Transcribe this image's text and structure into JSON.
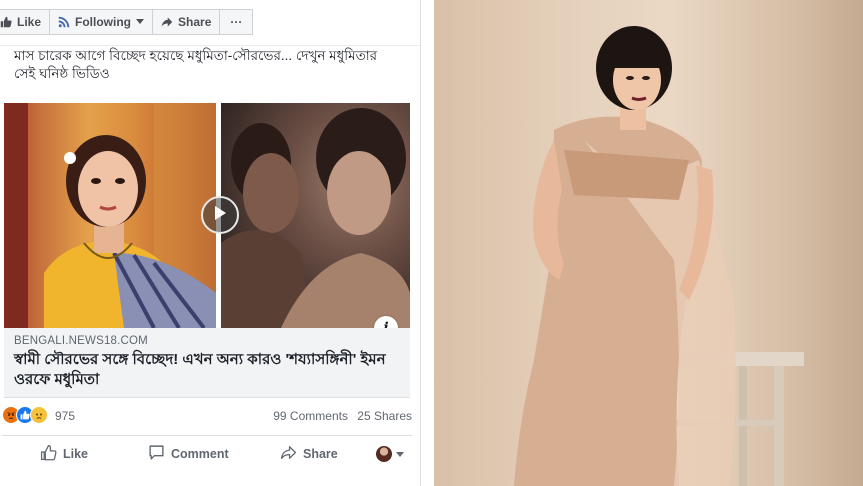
{
  "toolbar": {
    "like_label": "Like",
    "following_label": "Following",
    "share_label": "Share",
    "more_label": "···"
  },
  "post": {
    "caption": "মাস চারেক আগে বিচ্ছেদ হয়েছে মধুমিতা-সৌরভের... দেখুন মধুমিতার সেই ঘনিষ্ঠ ভিডিও",
    "link": {
      "domain": "BENGALI.NEWS18.COM",
      "headline": "স্বামী সৌরভের সঙ্গে বিচ্ছেদ! এখন অন্য কারও 'শয্যাসঙ্গিনী' ইমন ওরফে মধুমিতা"
    },
    "reactions": {
      "icons": [
        "angry-icon",
        "like-reaction-icon",
        "sad-icon"
      ],
      "count": "975"
    },
    "comments_label": "99 Comments",
    "shares_label": "25 Shares",
    "actions": {
      "like": "Like",
      "comment": "Comment",
      "share": "Share"
    }
  },
  "colors": {
    "facebook_blue": "#4267b2",
    "text_primary": "#1d2129",
    "text_secondary": "#606770",
    "link_box_bg": "#f2f3f5"
  }
}
